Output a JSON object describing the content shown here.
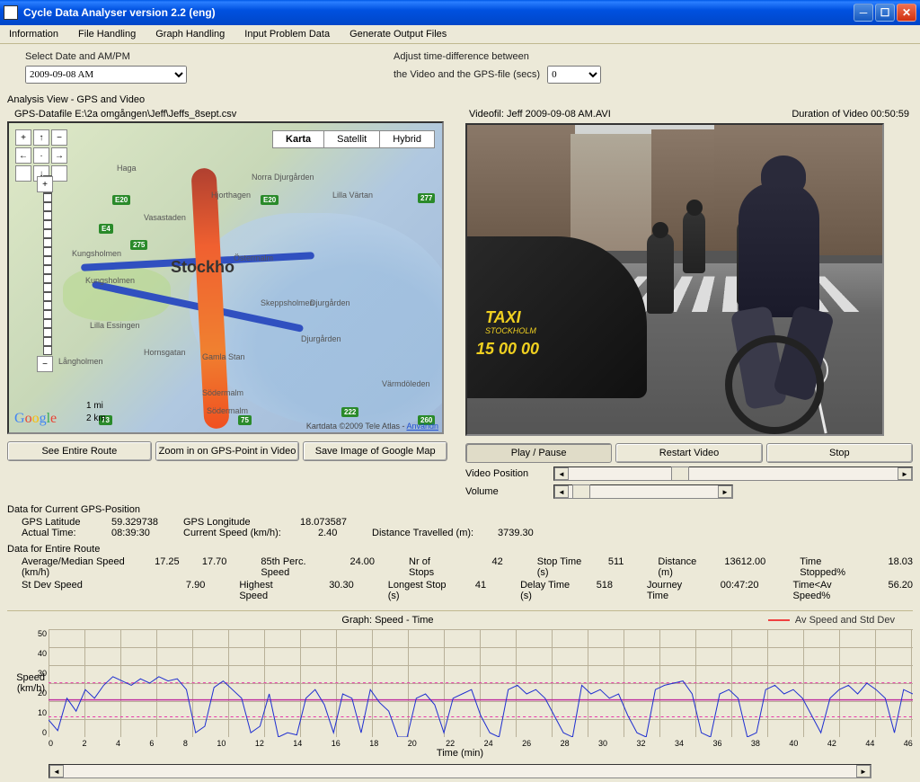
{
  "window": {
    "title": "Cycle Data Analyser   version 2.2 (eng)"
  },
  "menu": {
    "info": "Information",
    "file": "File Handling",
    "graph": "Graph Handling",
    "input": "Input Problem Data",
    "output": "Generate Output Files"
  },
  "top": {
    "date_label": "Select Date and AM/PM",
    "date_value": "2009-09-08 AM",
    "time_label1": "Adjust time-difference between",
    "time_label2": "the Video and the GPS-file (secs)",
    "time_value": "0"
  },
  "analysis_title": "Analysis View - GPS and Video",
  "gps": {
    "file_label": "GPS-Datafile  E:\\2a omgången\\Jeff\\Jeffs_8sept.csv"
  },
  "map": {
    "type_karta": "Karta",
    "type_sat": "Satellit",
    "type_hybrid": "Hybrid",
    "city": "Stockho",
    "credits": "Kartdata ©2009 Tele Atlas - ",
    "terms": "Användn",
    "mi": "1 mi",
    "km": "2 km",
    "labels": {
      "kungsholmen": "Kungsholmen",
      "haga": "Haga",
      "ostermalm": "Östermalm",
      "gamla": "Gamla Stan",
      "djurgarden": "Djurgården",
      "essingen": "Lilla Essingen",
      "djurgarden2": "Djurgården",
      "sodermalm": "Södermalm",
      "vasastaden": "Vasastaden",
      "lilla": "Lilla Värtan",
      "norra": "Norra Djurgården",
      "hjorthagen": "Hjorthagen",
      "varmdoleden": "Värmdöleden",
      "sodermalm2": "Södermalm",
      "langholmen": "Långholmen",
      "hornsgatan": "Hornsgatan",
      "kungsholmen2": "Kungsholmen",
      "skeppsholmen": "Skeppsholmen"
    },
    "shields": {
      "e20": "E20",
      "e4": "E4",
      "e20b": "E20",
      "n275": "275",
      "n277": "277",
      "n260": "260",
      "n73": "73",
      "n222": "222",
      "n75": "75"
    },
    "btn_full": "See Entire Route",
    "btn_zoom": "Zoom in on GPS-Point in Video",
    "btn_save": "Save Image of Google Map"
  },
  "video": {
    "file_label": "Videofil:   Jeff   2009-09-08 AM.AVI",
    "dur_label": "Duration of Video   00:50:59",
    "taxi": "TAXI",
    "taxi_city": "STOCKHOLM",
    "taxi_phone": "15 00 00",
    "btn_play": "Play / Pause",
    "btn_restart": "Restart Video",
    "btn_stop": "Stop",
    "pos_label": "Video Position",
    "vol_label": "Volume"
  },
  "gpsdata": {
    "title": "Data for Current GPS-Position",
    "lat_l": "GPS Latitude",
    "lat_v": "59.329738",
    "lon_l": "GPS Longitude",
    "lon_v": "18.073587",
    "time_l": "Actual Time:",
    "time_v": "08:39:30",
    "spd_l": "Current Speed (km/h):",
    "spd_v": "2.40",
    "dist_l": "Distance Travelled (m):",
    "dist_v": "3739.30"
  },
  "routedata": {
    "title": "Data for Entire Route",
    "avg_l": "Average/Median Speed (km/h)",
    "avg_v1": "17.25",
    "avg_v2": "17.70",
    "p85_l": "85th Perc. Speed",
    "p85_v": "24.00",
    "stops_l": "Nr of Stops",
    "stops_v": "42",
    "stoptime_l": "Stop Time (s)",
    "stoptime_v": "511",
    "dist_l": "Distance (m)",
    "dist_v": "13612.00",
    "timestop_l": "Time Stopped%",
    "timestop_v": "18.03",
    "std_l": "St Dev Speed",
    "std_v": "7.90",
    "high_l": "Highest Speed",
    "high_v": "30.30",
    "long_l": "Longest Stop (s)",
    "long_v": "41",
    "delay_l": "Delay Time (s)",
    "delay_v": "518",
    "jtime_l": "Journey Time",
    "jtime_v": "00:47:20",
    "tavg_l": "Time<Av Speed%",
    "tavg_v": "56.20"
  },
  "chart": {
    "title": "Graph: Speed - Time",
    "legend": "Av Speed and Std Dev",
    "ylabel1": "Speed",
    "ylabel2": "(km/h)",
    "xlabel": "Time (min)",
    "yticks": [
      "50",
      "40",
      "30",
      "20",
      "10",
      "0"
    ],
    "xticks": [
      "0",
      "2",
      "4",
      "6",
      "8",
      "10",
      "12",
      "14",
      "16",
      "18",
      "20",
      "22",
      "24",
      "26",
      "28",
      "30",
      "32",
      "34",
      "36",
      "38",
      "40",
      "42",
      "44",
      "46"
    ]
  },
  "chart_data": {
    "type": "line",
    "title": "Graph: Speed - Time",
    "xlabel": "Time (min)",
    "ylabel": "Speed (km/h)",
    "ylim": [
      0,
      50
    ],
    "xlim": [
      0,
      47
    ],
    "avg": 17.25,
    "std": 7.9,
    "x": [
      0,
      0.5,
      1,
      1.5,
      2,
      2.5,
      3,
      3.5,
      4,
      4.5,
      5,
      5.5,
      6,
      6.5,
      7,
      7.5,
      8,
      8.5,
      9,
      9.5,
      10,
      10.5,
      11,
      11.5,
      12,
      12.5,
      13,
      13.5,
      14,
      14.5,
      15,
      15.5,
      16,
      16.5,
      17,
      17.5,
      18,
      18.5,
      19,
      19.5,
      20,
      20.5,
      21,
      21.5,
      22,
      22.5,
      23,
      23.5,
      24,
      24.5,
      25,
      25.5,
      26,
      26.5,
      27,
      27.5,
      28,
      28.5,
      29,
      29.5,
      30,
      30.5,
      31,
      31.5,
      32,
      32.5,
      33,
      33.5,
      34,
      34.5,
      35,
      35.5,
      36,
      36.5,
      37,
      37.5,
      38,
      38.5,
      39,
      39.5,
      40,
      40.5,
      41,
      41.5,
      42,
      42.5,
      43,
      43.5,
      44,
      44.5,
      45,
      45.5,
      46,
      46.5,
      47
    ],
    "values": [
      8,
      3,
      18,
      12,
      22,
      18,
      24,
      28,
      26,
      24,
      27,
      25,
      28,
      26,
      27,
      22,
      2,
      5,
      23,
      26,
      22,
      18,
      2,
      5,
      20,
      0,
      2,
      1,
      18,
      22,
      15,
      2,
      20,
      18,
      2,
      22,
      16,
      12,
      0,
      0,
      18,
      20,
      15,
      2,
      18,
      20,
      22,
      10,
      2,
      0,
      22,
      24,
      20,
      22,
      18,
      10,
      2,
      0,
      24,
      20,
      22,
      18,
      20,
      10,
      2,
      0,
      22,
      24,
      25,
      26,
      20,
      2,
      0,
      20,
      22,
      18,
      0,
      2,
      22,
      24,
      20,
      22,
      18,
      10,
      2,
      18,
      22,
      24,
      20,
      25,
      22,
      18,
      2,
      22,
      20
    ]
  }
}
